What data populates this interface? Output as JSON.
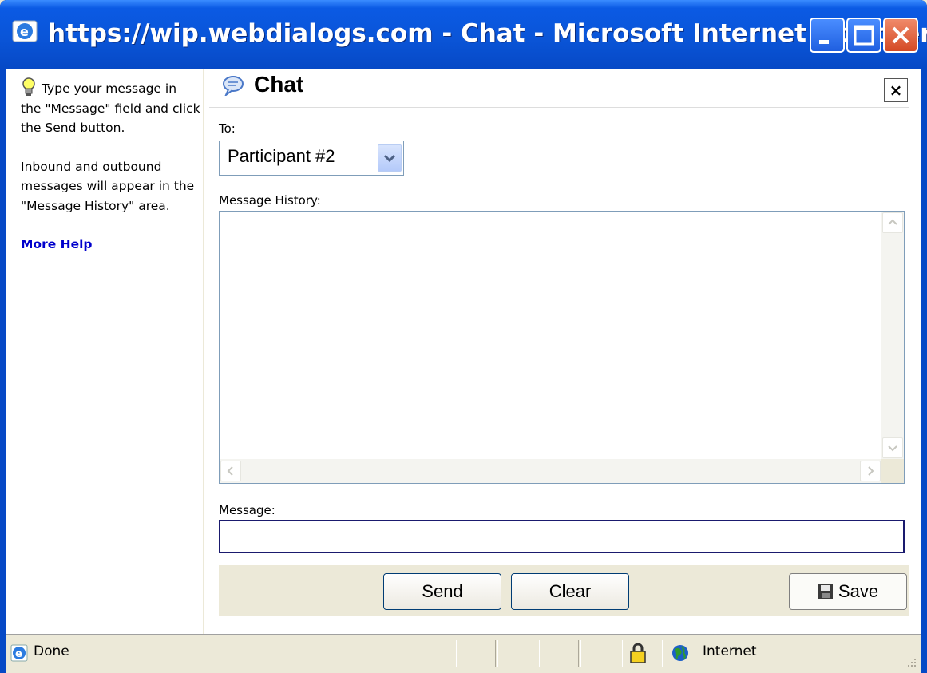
{
  "window": {
    "title": "https://wip.webdialogs.com - Chat - Microsoft Internet Explorer",
    "controls": [
      "minimize",
      "maximize",
      "close"
    ]
  },
  "help": {
    "intro": "Type your message in the \"Message\" field and click the Send button.",
    "detail": "Inbound and outbound messages will appear in the \"Message History\" area.",
    "link": "More Help",
    "icon": "lightbulb-icon"
  },
  "chat": {
    "title": "Chat",
    "close_label": "×",
    "to_label": "To:",
    "recipient": "Participant #2",
    "history_label": "Message History:",
    "message_label": "Message:",
    "message_value": "",
    "send_label": "Send",
    "clear_label": "Clear",
    "save_label": "Save"
  },
  "status": {
    "text": "Done",
    "zone": "Internet"
  },
  "colors": {
    "titlebar": "#0a55d8",
    "link": "#0000cc",
    "input_border": "#1a1a6e",
    "chrome": "#ece9d8"
  }
}
